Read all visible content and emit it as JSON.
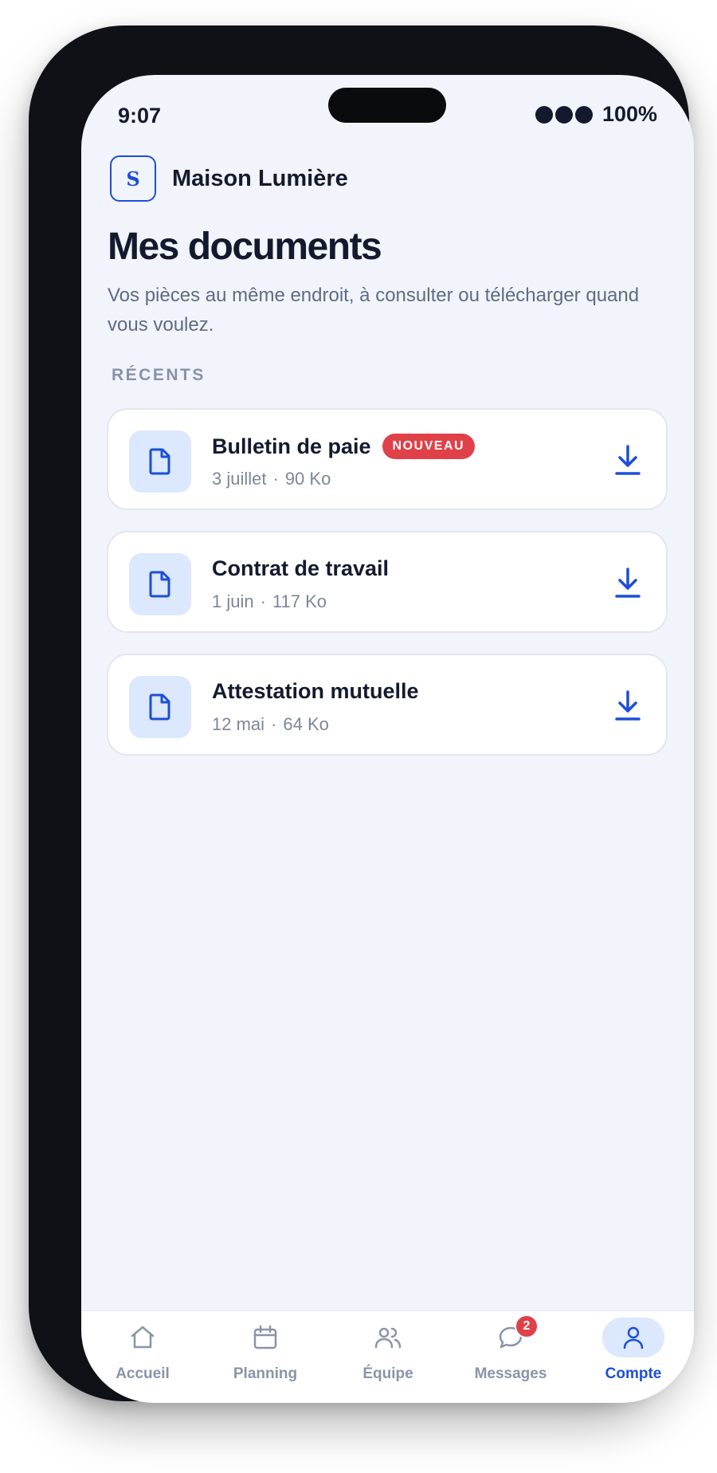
{
  "status_bar": {
    "time": "9:07",
    "battery": "100%"
  },
  "brand": {
    "logo_letter": "S",
    "name": "Maison Lumière"
  },
  "page": {
    "title": "Mes documents",
    "subtitle": "Vos pièces au même endroit, à consulter ou télécharger quand vous voulez."
  },
  "section": {
    "label": "RÉCENTS"
  },
  "documents": [
    {
      "title": "Bulletin de paie",
      "badge": "NOUVEAU",
      "date": "3 juillet",
      "size": "90 Ko",
      "icon": "file-icon"
    },
    {
      "title": "Contrat de travail",
      "badge": "",
      "date": "1 juin",
      "size": "117 Ko",
      "icon": "file-icon"
    },
    {
      "title": "Attestation mutuelle",
      "badge": "",
      "date": "12 mai",
      "size": "64 Ko",
      "icon": "file-icon"
    }
  ],
  "meta_separator": "·",
  "tabbar": {
    "items": [
      {
        "label": "Accueil",
        "icon": "home-icon"
      },
      {
        "label": "Planning",
        "icon": "calendar-icon"
      },
      {
        "label": "Équipe",
        "icon": "team-icon"
      },
      {
        "label": "Messages",
        "icon": "chat-icon",
        "badge": "2"
      },
      {
        "label": "Compte",
        "icon": "user-icon",
        "active": true
      }
    ]
  },
  "colors": {
    "accent": "#1d4ed8",
    "badge": "#e04149",
    "background": "#f2f4fb",
    "text": "#141a2e"
  }
}
